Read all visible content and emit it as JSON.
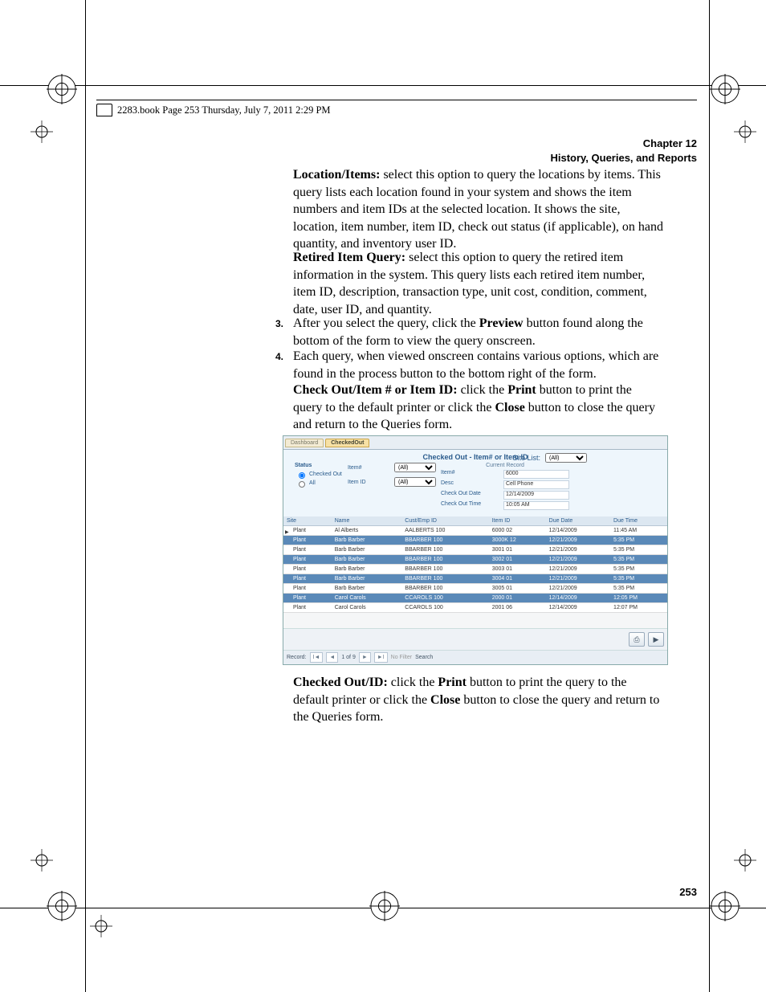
{
  "header": {
    "running_title": "2283.book  Page 253  Thursday, July 7, 2011  2:29 PM"
  },
  "chapter": {
    "label": "Chapter 12",
    "title": "History, Queries, and Reports"
  },
  "paragraphs": {
    "p1_bold": "Location/Items:",
    "p1": " select this option to query the locations by items. This query lists each location found in your system and shows the item numbers and item IDs at the selected location. It shows the site, location, item number, item ID, check out status (if applicable), on hand quantity, and inventory user ID.",
    "p2_bold": "Retired Item Query:",
    "p2": " select this option to query the retired item information in the system. This query lists each retired item number, item ID, description, transaction type, unit cost, condition, comment, date, user ID, and quantity.",
    "step3_num": "3.",
    "step3_a": "After you select the query, click the ",
    "step3_bold1": "Preview",
    "step3_b": " button found along the bottom of the form to view the query onscreen.",
    "step4_num": "4.",
    "step4": "Each query, when viewed onscreen contains various options, which are found in the process button to the bottom right of the form.",
    "p5_bold": "Check Out/Item # or Item ID:",
    "p5_a": " click the ",
    "p5_bold2": "Print",
    "p5_b": " button to print the query to the default printer or click the ",
    "p5_bold3": "Close",
    "p5_c": " button to close the query and return to the Queries form.",
    "p6_bold": "Checked Out/ID:",
    "p6_a": " click the ",
    "p6_bold2": "Print",
    "p6_b": " button to print the query to the default printer or click the ",
    "p6_bold3": "Close",
    "p6_c": " button to close the query and return to the Queries form."
  },
  "screenshot": {
    "tabs": {
      "dashboard": "Dashboard",
      "checkedout": "CheckedOut"
    },
    "title": "Checked Out - Item# or Item ID",
    "site_list_label": "Site List:",
    "site_list_value": "(All)",
    "status": {
      "label": "Status",
      "opt1": "Checked Out",
      "opt2": "All"
    },
    "itemnum_label": "Item#",
    "itemnum_value": "(All)",
    "itemid_label": "Item ID",
    "itemid_value": "(All)",
    "current_record": {
      "header": "Current Record",
      "itemnum_label": "Item#",
      "itemnum": "6000",
      "desc_label": "Desc",
      "desc": "Cell Phone",
      "codate_label": "Check Out Date",
      "codate": "12/14/2009",
      "cotime_label": "Check Out Time",
      "cotime": "10:05 AM"
    },
    "columns": [
      "Site",
      "Name",
      "Cust/Emp ID",
      "Item ID",
      "Due Date",
      "Due Time"
    ],
    "rows": [
      {
        "site": "Plant",
        "name": "Al Alberts",
        "cust": "AALBERTS 100",
        "item": "6000 02",
        "due_date": "12/14/2009",
        "due_time": "11:45 AM",
        "alt": false,
        "ptr": true
      },
      {
        "site": "Plant",
        "name": "Barb Barber",
        "cust": "BBARBER 100",
        "item": "3000K 12",
        "due_date": "12/21/2009",
        "due_time": "5:35 PM",
        "alt": true
      },
      {
        "site": "Plant",
        "name": "Barb Barber",
        "cust": "BBARBER 100",
        "item": "3001 01",
        "due_date": "12/21/2009",
        "due_time": "5:35 PM",
        "alt": false
      },
      {
        "site": "Plant",
        "name": "Barb Barber",
        "cust": "BBARBER 100",
        "item": "3002 01",
        "due_date": "12/21/2009",
        "due_time": "5:35 PM",
        "alt": true
      },
      {
        "site": "Plant",
        "name": "Barb Barber",
        "cust": "BBARBER 100",
        "item": "3003 01",
        "due_date": "12/21/2009",
        "due_time": "5:35 PM",
        "alt": false
      },
      {
        "site": "Plant",
        "name": "Barb Barber",
        "cust": "BBARBER 100",
        "item": "3004 01",
        "due_date": "12/21/2009",
        "due_time": "5:35 PM",
        "alt": true
      },
      {
        "site": "Plant",
        "name": "Barb Barber",
        "cust": "BBARBER 100",
        "item": "3005 01",
        "due_date": "12/21/2009",
        "due_time": "5:35 PM",
        "alt": false
      },
      {
        "site": "Plant",
        "name": "Carol Carols",
        "cust": "CCAROLS 100",
        "item": "2000 01",
        "due_date": "12/14/2009",
        "due_time": "12:05 PM",
        "alt": true
      },
      {
        "site": "Plant",
        "name": "Carol Carols",
        "cust": "CCAROLS 100",
        "item": "2001 06",
        "due_date": "12/14/2009",
        "due_time": "12:07 PM",
        "alt": false
      }
    ],
    "nav": {
      "label": "Record:",
      "pos": "1 of 9",
      "first": "I◄",
      "prev": "◄",
      "next": "►",
      "last": "►I",
      "nofilter": "No Filter",
      "search": "Search"
    }
  },
  "page_number": "253"
}
